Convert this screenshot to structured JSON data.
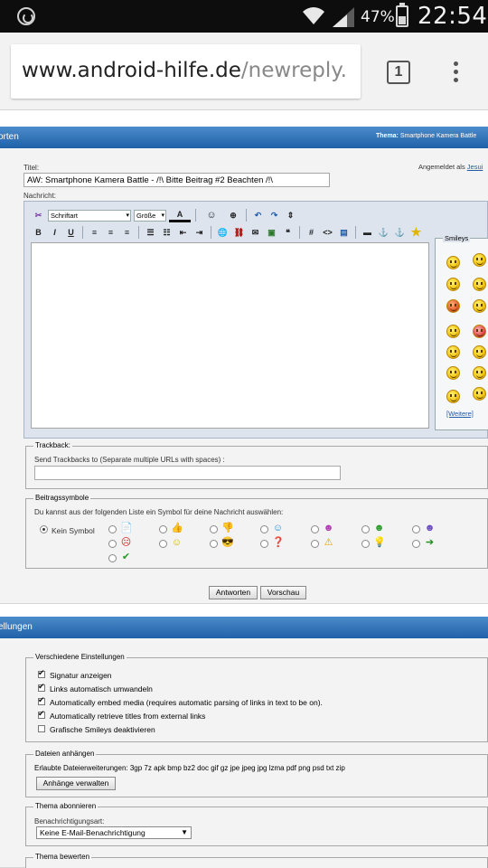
{
  "status_bar": {
    "battery_percent": "47%",
    "battery_level": 0.47,
    "clock": "22:54",
    "icons": [
      "app-notification-icon",
      "wifi-icon",
      "signal-icon",
      "battery-icon"
    ]
  },
  "browser": {
    "url_domain": "www.android-hilfe.de",
    "url_path": "/newreply.",
    "tab_count": "1"
  },
  "reply_bar": {
    "label": "orten",
    "thema_label": "Thema:",
    "thema_value": "Smartphone Kamera Battle"
  },
  "form": {
    "title_label": "Titel:",
    "title_value": "AW: Smartphone Kamera Battle -  /!\\ Bitte Beitrag #2 Beachten /!\\",
    "signed_in_label": "Angemeldet als",
    "signed_in_user": "Jesui",
    "message_label": "Nachricht:"
  },
  "editor_toolbar": {
    "font_select": "Schriftart",
    "size_select": "Größe",
    "bold": "B",
    "italic": "I",
    "underline": "U",
    "font_color": "A",
    "code": "<>",
    "hash": "#"
  },
  "smileys": {
    "title": "Smileys",
    "more_link": "[Weitere]"
  },
  "trackback": {
    "legend": "Trackback:",
    "label": "Send Trackbacks to (Separate multiple URLs with spaces) :",
    "value": ""
  },
  "post_icons": {
    "legend": "Beitragssymbole",
    "description": "Du kannst aus der folgenden Liste ein Symbol für deine Nachricht auswählen:",
    "none_label": "Kein Symbol"
  },
  "buttons": {
    "submit": "Antworten",
    "preview": "Vorschau"
  },
  "settings_bar": {
    "label": "ellungen"
  },
  "misc_settings": {
    "legend": "Verschiedene Einstellungen",
    "options": [
      {
        "label": "Signatur anzeigen",
        "checked": true
      },
      {
        "label": "Links automatisch umwandeln",
        "checked": true
      },
      {
        "label": "Automatically embed media (requires automatic parsing of links in text to be on).",
        "checked": true
      },
      {
        "label": "Automatically retrieve titles from external links",
        "checked": true
      },
      {
        "label": "Grafische Smileys deaktivieren",
        "checked": false
      }
    ]
  },
  "attachments": {
    "legend": "Dateien anhängen",
    "extensions_text": "Erlaubte Dateierweiterungen: 3gp 7z apk bmp bz2 doc gif gz jpe jpeg jpg lzma pdf png psd txt zip",
    "manage_button": "Anhänge verwalten"
  },
  "subscribe": {
    "legend": "Thema abonnieren",
    "label": "Benachrichtigungsart:",
    "selected": "Keine E-Mail-Benachrichtigung"
  },
  "rate": {
    "legend": "Thema bewerten"
  }
}
